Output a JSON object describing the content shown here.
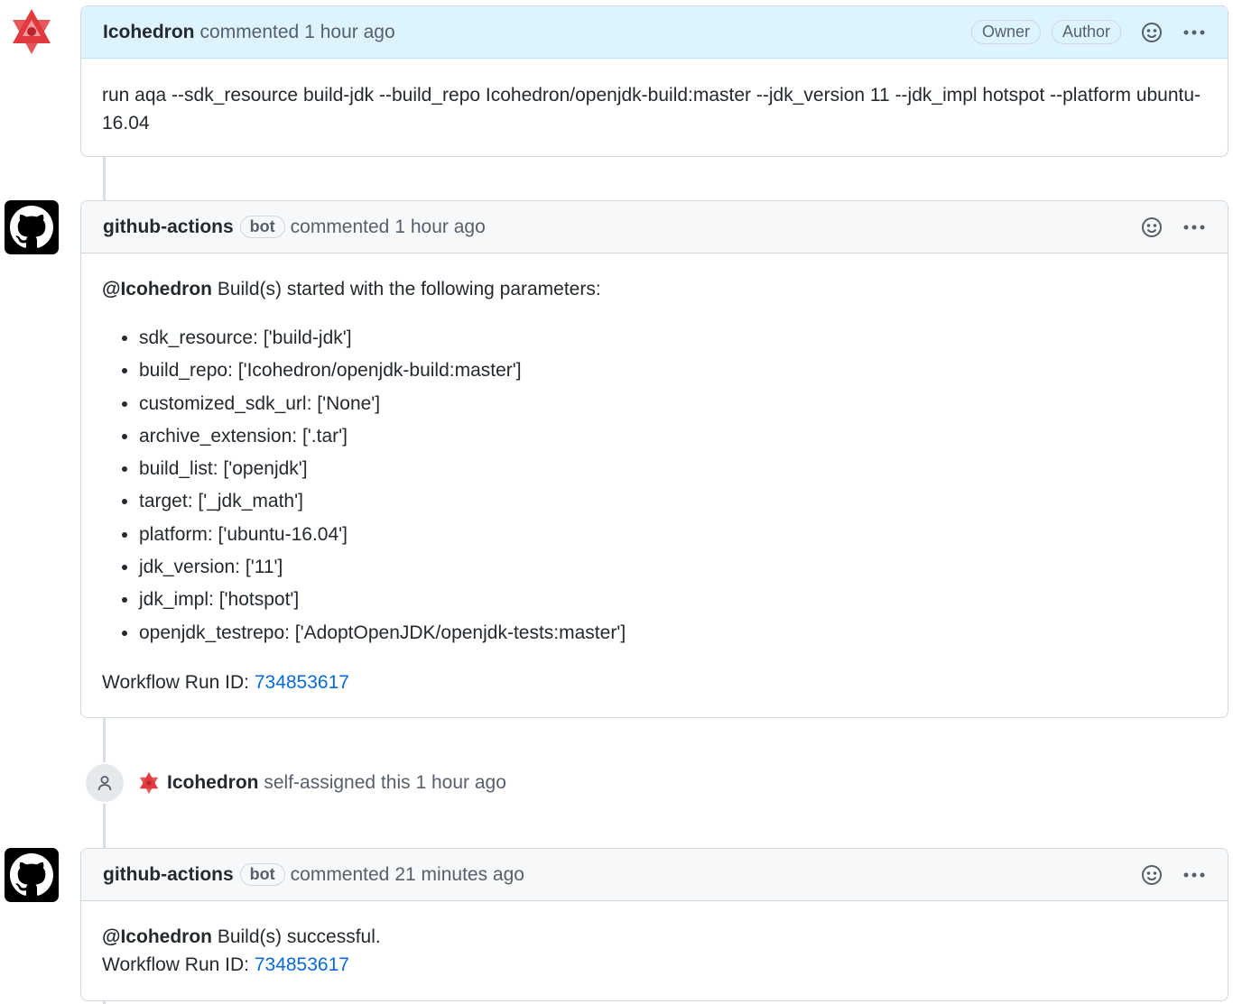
{
  "comments": [
    {
      "author": "Icohedron",
      "action": "commented",
      "time": "1 hour ago",
      "badges": [
        "Owner",
        "Author"
      ],
      "body": "run aqa --sdk_resource build-jdk --build_repo Icohedron/openjdk-build:master --jdk_version 11 --jdk_impl hotspot --platform ubuntu-16.04"
    },
    {
      "author": "github-actions",
      "bot_label": "bot",
      "action": "commented",
      "time": "1 hour ago",
      "mention": "@Icohedron",
      "intro": "Build(s) started with the following parameters:",
      "params": [
        "sdk_resource: ['build-jdk']",
        "build_repo: ['Icohedron/openjdk-build:master']",
        "customized_sdk_url: ['None']",
        "archive_extension: ['.tar']",
        "build_list: ['openjdk']",
        "target: ['_jdk_math']",
        "platform: ['ubuntu-16.04']",
        "jdk_version: ['11']",
        "jdk_impl: ['hotspot']",
        "openjdk_testrepo: ['AdoptOpenJDK/openjdk-tests:master']"
      ],
      "workflow_label": "Workflow Run ID:",
      "workflow_id": "734853617"
    },
    {
      "author": "github-actions",
      "bot_label": "bot",
      "action": "commented",
      "time": "21 minutes ago",
      "mention": "@Icohedron",
      "message": "Build(s) successful.",
      "workflow_label": "Workflow Run ID:",
      "workflow_id": "734853617"
    }
  ],
  "event": {
    "actor": "Icohedron",
    "text": "self-assigned this",
    "time": "1 hour ago",
    "icon": "person-icon"
  },
  "icons": {
    "reaction": "smiley-icon",
    "menu": "kebab-icon"
  },
  "colors": {
    "link": "#0969da",
    "owner_header": "#ddf4ff",
    "avatar_red": "#e03a3e"
  }
}
